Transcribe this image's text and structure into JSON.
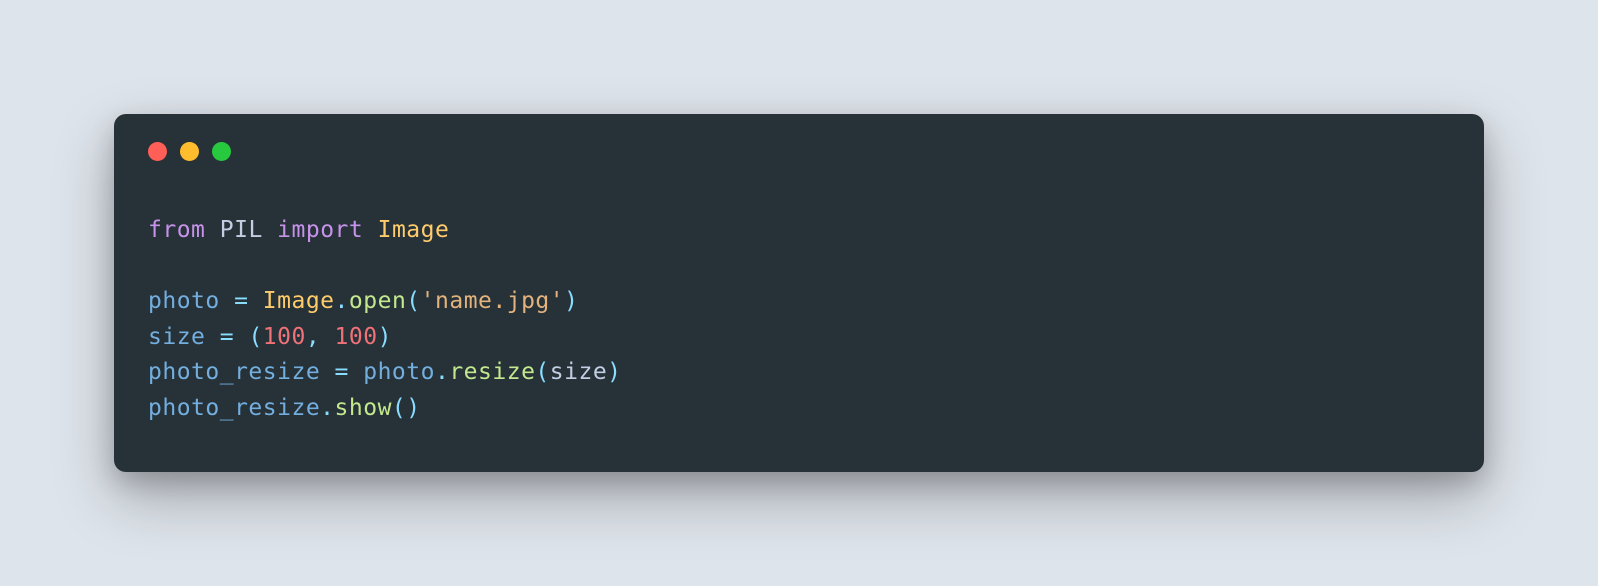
{
  "code": {
    "line1": {
      "kw_from": "from",
      "module": "PIL",
      "kw_import": "import",
      "cls": "Image"
    },
    "line3": {
      "var": "photo",
      "assign": " = ",
      "cls": "Image",
      "dot": ".",
      "fn": "open",
      "lparen": "(",
      "str": "'name.jpg'",
      "rparen": ")"
    },
    "line4": {
      "var": "size",
      "assign": " = ",
      "lparen": "(",
      "num1": "100",
      "comma": ", ",
      "num2": "100",
      "rparen": ")"
    },
    "line5": {
      "var": "photo_resize",
      "assign": " = ",
      "obj": "photo",
      "dot": ".",
      "fn": "resize",
      "lparen": "(",
      "arg": "size",
      "rparen": ")"
    },
    "line6": {
      "obj": "photo_resize",
      "dot": ".",
      "fn": "show",
      "lparen": "(",
      "rparen": ")"
    }
  }
}
